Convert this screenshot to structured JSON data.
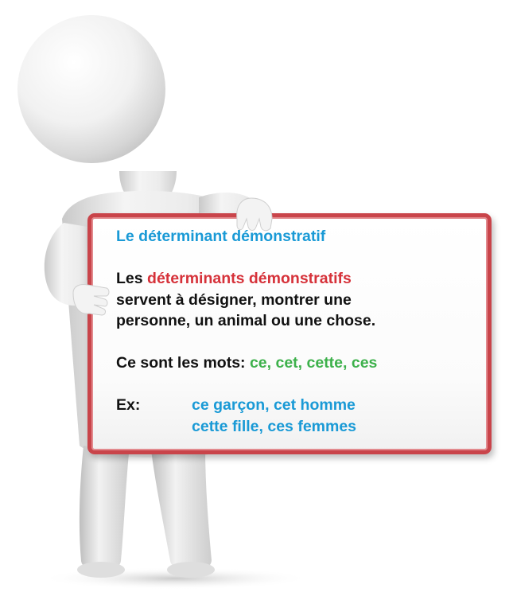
{
  "board": {
    "title": "Le déterminant démonstratif",
    "definition": {
      "prefix": "Les ",
      "term": "déterminants démonstratifs",
      "line2": "servent à désigner, montrer une",
      "line3": "personne, un animal ou une chose."
    },
    "words": {
      "prefix": "Ce sont les mots: ",
      "list": "ce, cet, cette, ces"
    },
    "example": {
      "label": "Ex:",
      "line1": "ce garçon, cet homme",
      "line2": "cette fille, ces femmes"
    }
  },
  "colors": {
    "title": "#1a9ad6",
    "term": "#d6323a",
    "words": "#3db14b",
    "examples": "#1a9ad6",
    "board_border": "#c9444a"
  }
}
